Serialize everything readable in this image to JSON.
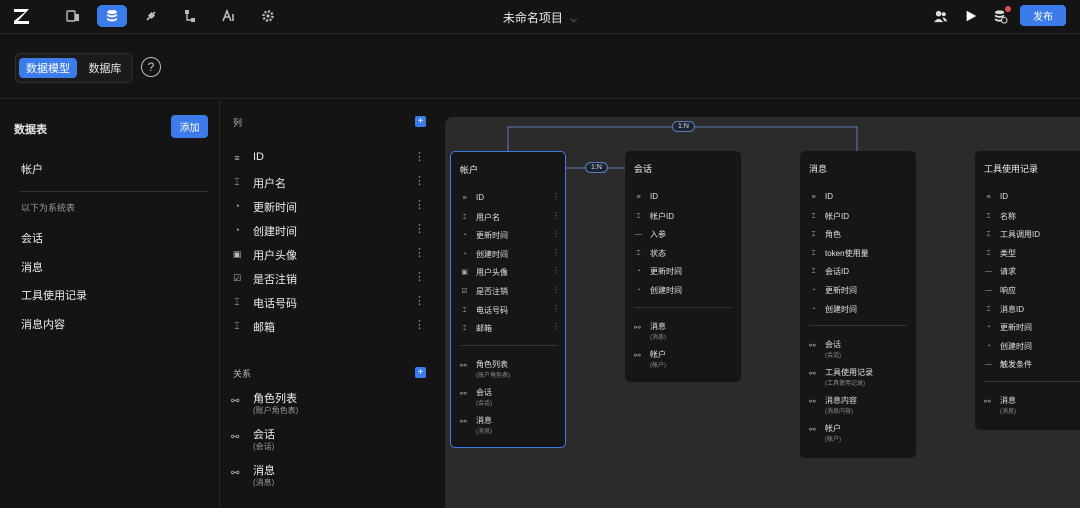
{
  "app": {
    "project_title": "未命名项目",
    "publish_label": "发布"
  },
  "toolbar_icons": [
    "layout-icon",
    "database-icon",
    "plugin-icon",
    "flow-icon",
    "ai-icon",
    "settings-icon"
  ],
  "tabs": {
    "data_model": "数据模型",
    "database": "数据库",
    "help": "?"
  },
  "tables_panel": {
    "title": "数据表",
    "add_label": "添加",
    "user_tables": [
      "帐户"
    ],
    "system_label": "以下为系统表",
    "system_tables": [
      "会话",
      "消息",
      "工具使用记录",
      "消息内容"
    ]
  },
  "columns_panel": {
    "columns_label": "列",
    "columns": [
      {
        "icon": "id-icon",
        "glyph": "≡",
        "name": "ID"
      },
      {
        "icon": "text-icon",
        "glyph": "⌶",
        "name": "用户名"
      },
      {
        "icon": "time-icon",
        "glyph": "◔",
        "name": "更新时间"
      },
      {
        "icon": "time-icon",
        "glyph": "◔",
        "name": "创建时间"
      },
      {
        "icon": "image-icon",
        "glyph": "▣",
        "name": "用户头像"
      },
      {
        "icon": "checkbox-icon",
        "glyph": "☑",
        "name": "是否注销"
      },
      {
        "icon": "text-icon",
        "glyph": "⌶",
        "name": "电话号码"
      },
      {
        "icon": "text-icon",
        "glyph": "⌶",
        "name": "邮箱"
      }
    ],
    "relations_label": "关系",
    "relations": [
      {
        "name": "角色列表",
        "sub": "(账户角色表)"
      },
      {
        "name": "会话",
        "sub": "(会话)"
      },
      {
        "name": "消息",
        "sub": "(消息)"
      }
    ]
  },
  "canvas": {
    "badges": [
      "1:N",
      "1:N"
    ],
    "cards": [
      {
        "title": "帐户",
        "fields": [
          "ID",
          "用户名",
          "更新时间",
          "创建时间",
          "用户头像",
          "是否注销",
          "电话号码",
          "邮箱"
        ],
        "relations": [
          {
            "name": "角色列表",
            "sub": "(账户角色表)"
          },
          {
            "name": "会话",
            "sub": "(会话)"
          },
          {
            "name": "消息",
            "sub": "(消息)"
          }
        ]
      },
      {
        "title": "会话",
        "fields": [
          "ID",
          "帐户ID",
          "入参",
          "状态",
          "更新时间",
          "创建时间"
        ],
        "relations": [
          {
            "name": "消息",
            "sub": "(消息)"
          },
          {
            "name": "帐户",
            "sub": "(帐户)"
          }
        ]
      },
      {
        "title": "消息",
        "fields": [
          "ID",
          "帐户ID",
          "角色",
          "token使用量",
          "会话ID",
          "更新时间",
          "创建时间"
        ],
        "relations": [
          {
            "name": "会话",
            "sub": "(会话)"
          },
          {
            "name": "工具使用记录",
            "sub": "(工具使用记录)"
          },
          {
            "name": "消息内容",
            "sub": "(消息内容)"
          },
          {
            "name": "帐户",
            "sub": "(帐户)"
          }
        ]
      },
      {
        "title": "工具使用记录",
        "fields": [
          "ID",
          "名称",
          "工具调用ID",
          "类型",
          "请求",
          "响应",
          "消息ID",
          "更新时间",
          "创建时间",
          "触发条件"
        ],
        "relations": [
          {
            "name": "消息",
            "sub": "(消息)"
          }
        ]
      }
    ]
  },
  "colors": {
    "accent": "#3b7bea",
    "background": "#141414",
    "canvas": "#2b2b2b",
    "card": "#161616"
  }
}
